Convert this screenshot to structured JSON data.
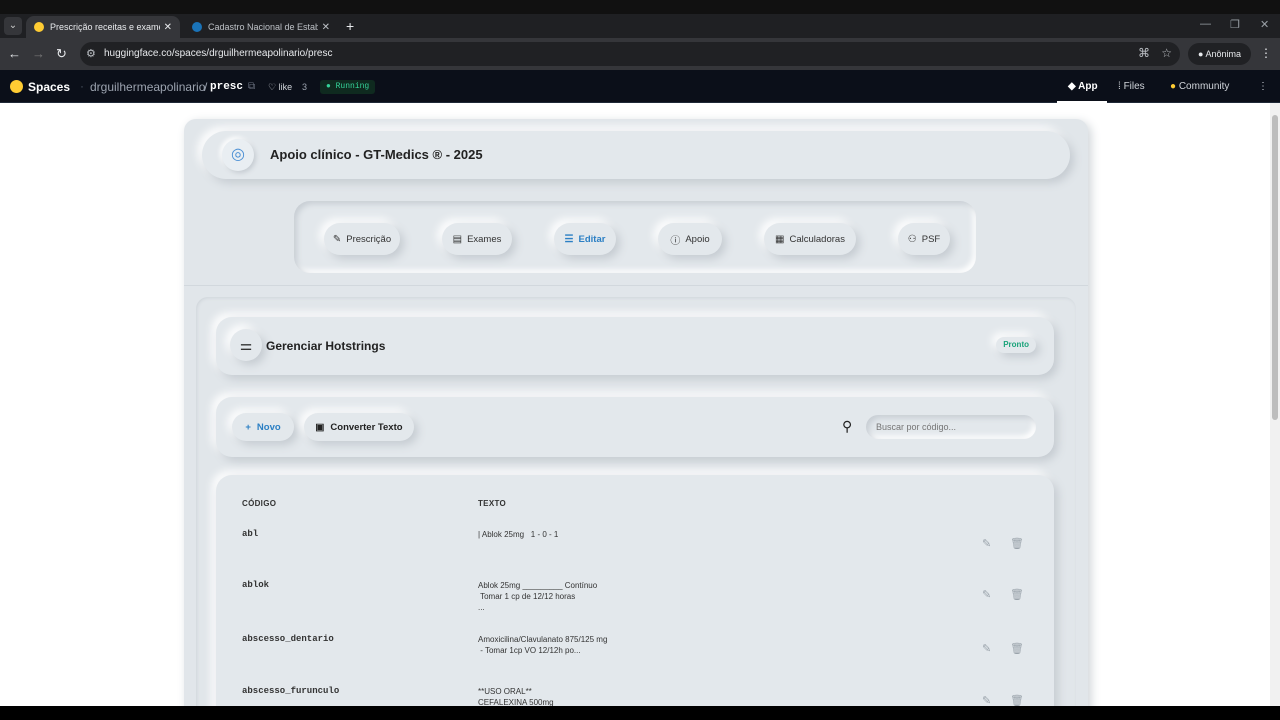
{
  "browser": {
    "tabs": [
      {
        "title": "Prescrição receitas e exames - u",
        "active": true
      },
      {
        "title": "Cadastro Nacional de Estabelec",
        "active": false
      }
    ],
    "url": "huggingface.co/spaces/drguilhermeapolinario/presc",
    "profile": "Anônima"
  },
  "hf": {
    "spaces": "Spaces",
    "owner": "drguilhermeapolinario",
    "repo": "presc",
    "like_label": "like",
    "like_count": "3",
    "status": "Running",
    "nav": {
      "app": "App",
      "files": "Files",
      "community": "Community"
    }
  },
  "app": {
    "title": "Apoio clínico - GT-Medics ® - 2025",
    "nav": [
      {
        "label": "Prescrição",
        "icon": "pen-icon"
      },
      {
        "label": "Exames",
        "icon": "document-icon"
      },
      {
        "label": "Editar",
        "icon": "sliders-icon",
        "active": true
      },
      {
        "label": "Apoio",
        "icon": "info-icon"
      },
      {
        "label": "Calculadoras",
        "icon": "calculator-icon"
      },
      {
        "label": "PSF",
        "icon": "group-icon"
      }
    ],
    "section_title": "Gerenciar Hotstrings",
    "status_badge": "Pronto",
    "toolbar": {
      "new_label": "Novo",
      "convert_label": "Converter Texto",
      "search_placeholder": "Buscar por código..."
    },
    "table": {
      "headers": {
        "code": "CÓDIGO",
        "text": "TEXTO"
      },
      "rows": [
        {
          "code": "abl",
          "text": "| Ablok 25mg   1 - 0 - 1"
        },
        {
          "code": "ablok",
          "text": "Ablok 25mg _________ Contínuo\n Tomar 1 cp de 12/12 horas\n..."
        },
        {
          "code": "abscesso_dentario",
          "text": "Amoxicilina/Clavulanato 875/125 mg\n - Tomar 1cp VO 12/12h po..."
        },
        {
          "code": "abscesso_furunculo",
          "text": "**USO ORAL**\nCEFALEXINA 500mg"
        }
      ]
    }
  },
  "colors": {
    "accent": "#2b7fc4",
    "ready": "#1aa37a",
    "running": "#34d399"
  }
}
